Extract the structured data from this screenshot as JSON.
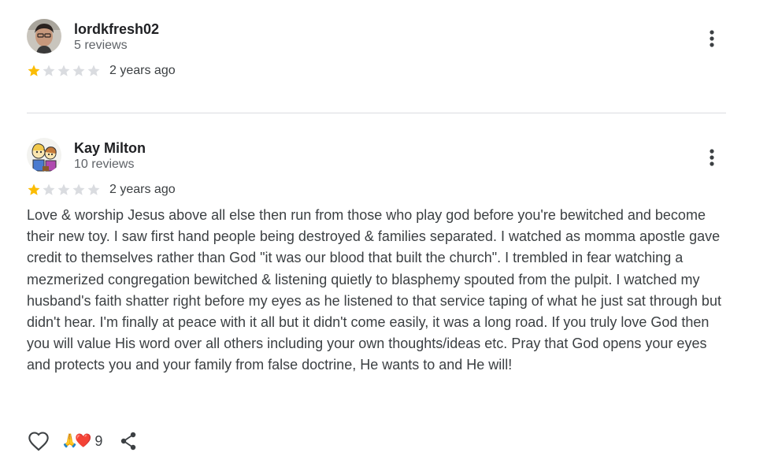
{
  "reviews": [
    {
      "name": "lordkfresh02",
      "meta": "5 reviews",
      "rating": 1,
      "max_rating": 5,
      "date": "2 years ago"
    },
    {
      "name": "Kay Milton",
      "meta": "10 reviews",
      "rating": 1,
      "max_rating": 5,
      "date": "2 years ago",
      "text": "Love & worship Jesus above all else then run from those who play god before you're bewitched and become their new toy. I saw first hand people being destroyed & families separated. I watched as momma apostle gave credit to themselves rather than God \"it was our blood that built the church\". I trembled in fear watching a mezmerized congregation bewitched & listening quietly to blasphemy spouted from the pulpit. I watched my husband's faith shatter right before my eyes as he listened to that service taping of what he just sat through but didn't hear. I'm finally at peace with it all but it didn't come easily, it was a long road. If you truly love God then you will value His word over all others including your own thoughts/ideas etc. Pray that God opens your eyes and protects you and your family from false doctrine, He wants to and He will!",
      "reactions": {
        "emoji": "🙏❤️",
        "count": "9"
      }
    }
  ],
  "colors": {
    "star_filled": "#fbbc04",
    "star_empty": "#dadce0",
    "text_primary": "#202124",
    "text_secondary": "#5f6368",
    "icon": "#3c4043"
  },
  "icons": {
    "more": "more-vert-icon",
    "like": "heart-outline-icon",
    "share": "share-icon"
  }
}
